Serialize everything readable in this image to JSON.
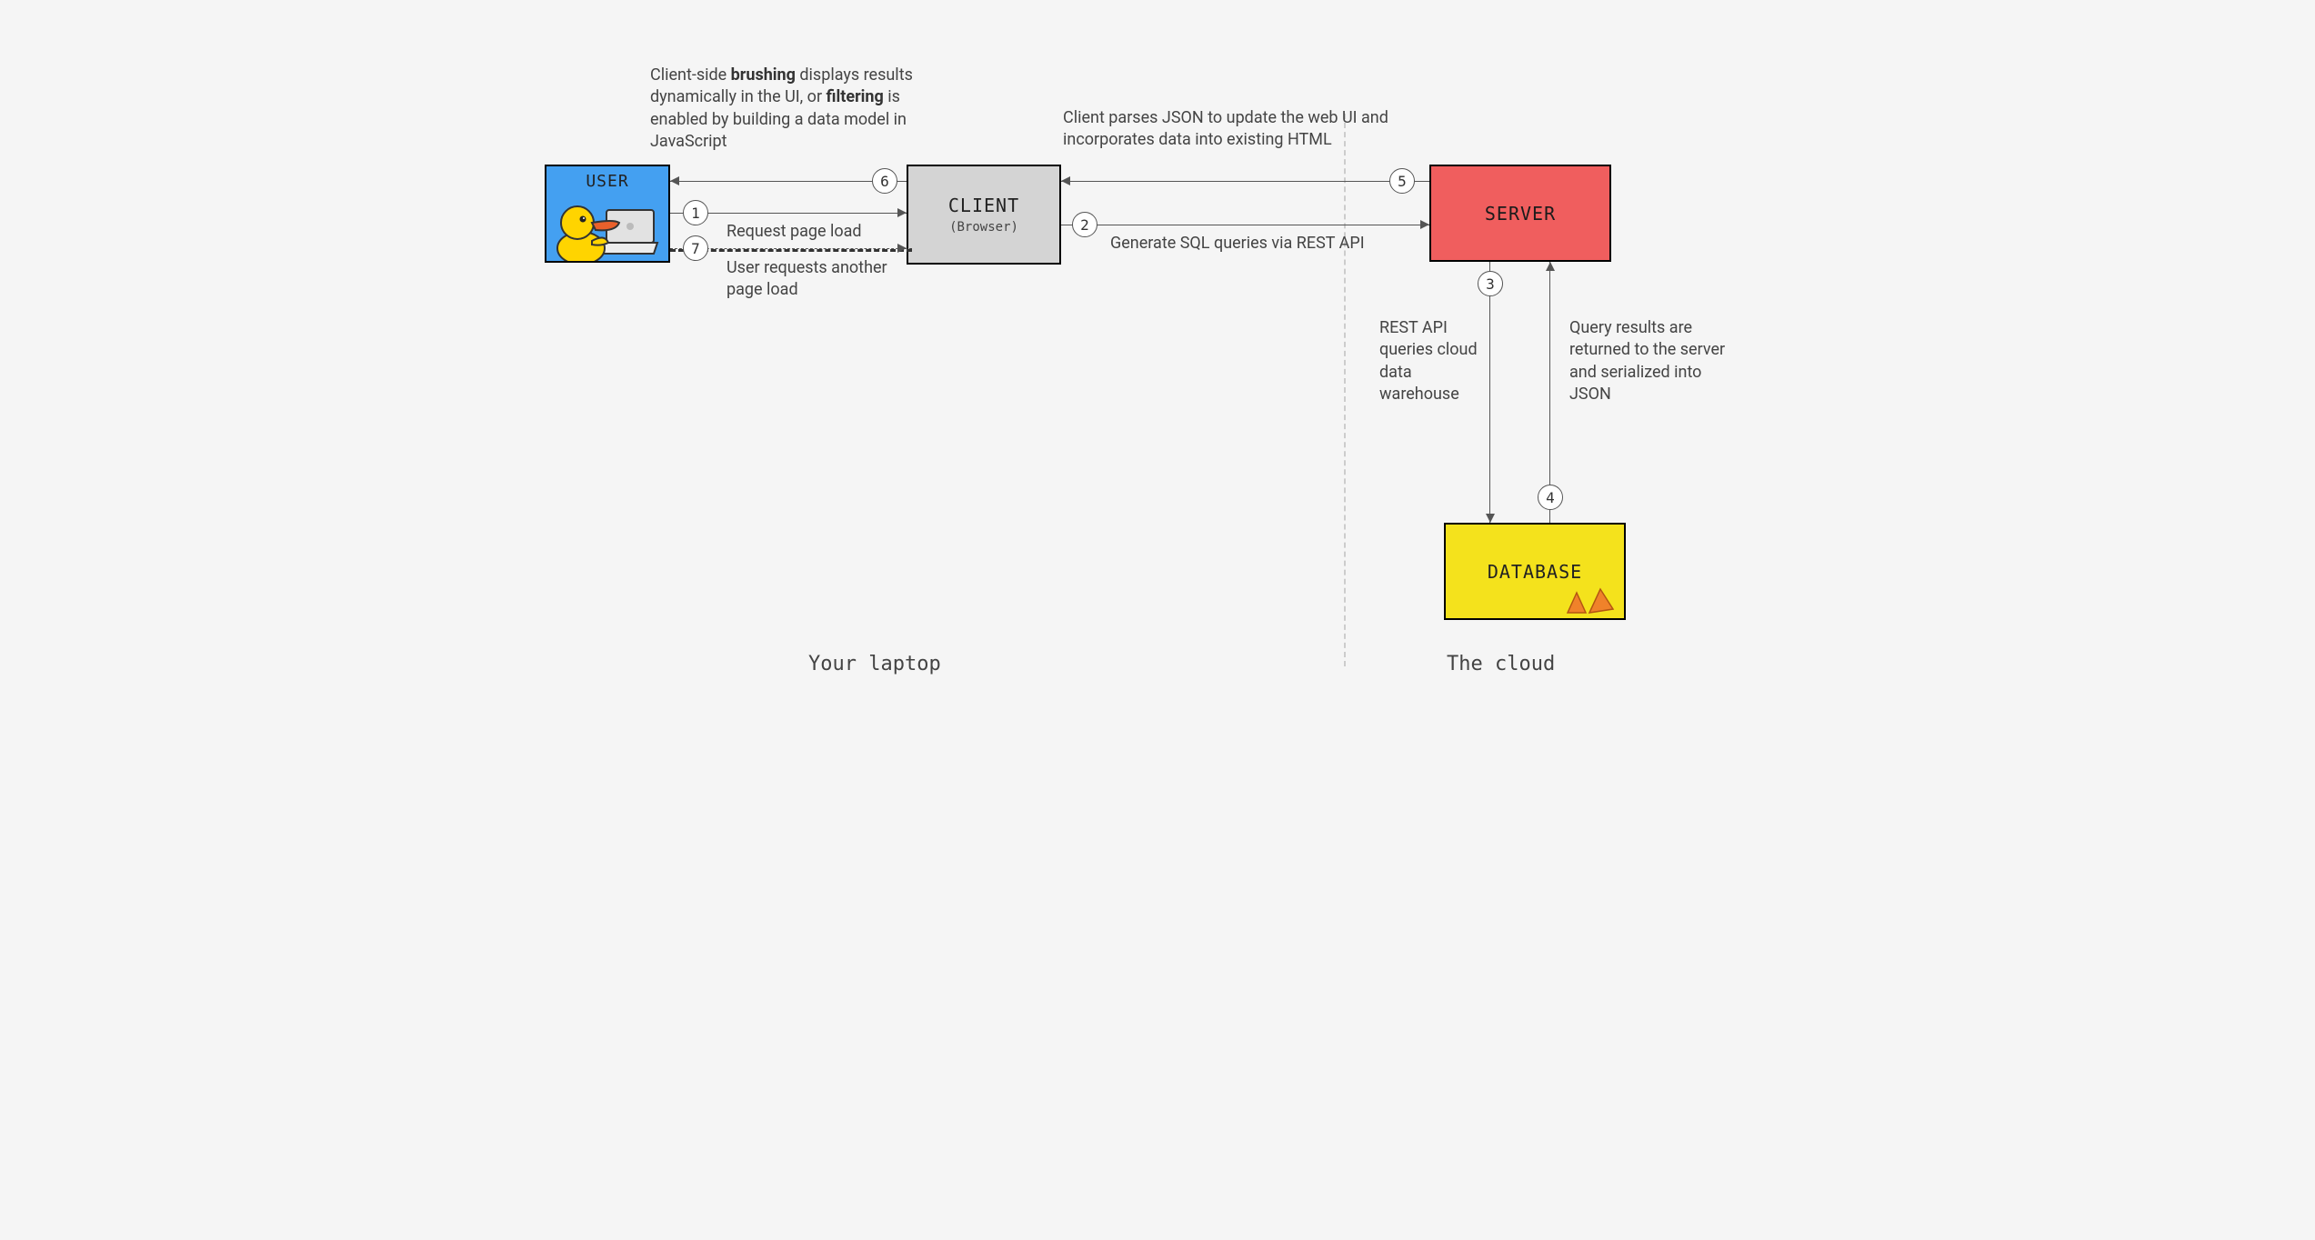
{
  "nodes": {
    "user": {
      "label": "USER"
    },
    "client": {
      "title": "CLIENT",
      "sub": "(Browser)"
    },
    "server": {
      "title": "SERVER"
    },
    "database": {
      "title": "DATABASE"
    }
  },
  "badges": {
    "one": "1",
    "two": "2",
    "three": "3",
    "four": "4",
    "five": "5",
    "six": "6",
    "seven": "7"
  },
  "captions": {
    "brushing_pre": "Client-side ",
    "brushing_b1": "brushing",
    "brushing_mid1": " displays results dynamically in the UI, or ",
    "brushing_b2": "filtering",
    "brushing_mid2": " is enabled by building a data model in JavaScript",
    "parse_json": "Client parses JSON to update the web UI and incorporates data into existing HTML",
    "request_load": "Request page load",
    "generate_sql": "Generate SQL queries via REST API",
    "another_load": "User requests another page load",
    "rest_query": "REST API queries cloud data warehouse",
    "query_results": "Query results are returned to the server and serialized into JSON"
  },
  "regions": {
    "laptop": "Your laptop",
    "cloud": "The cloud"
  }
}
